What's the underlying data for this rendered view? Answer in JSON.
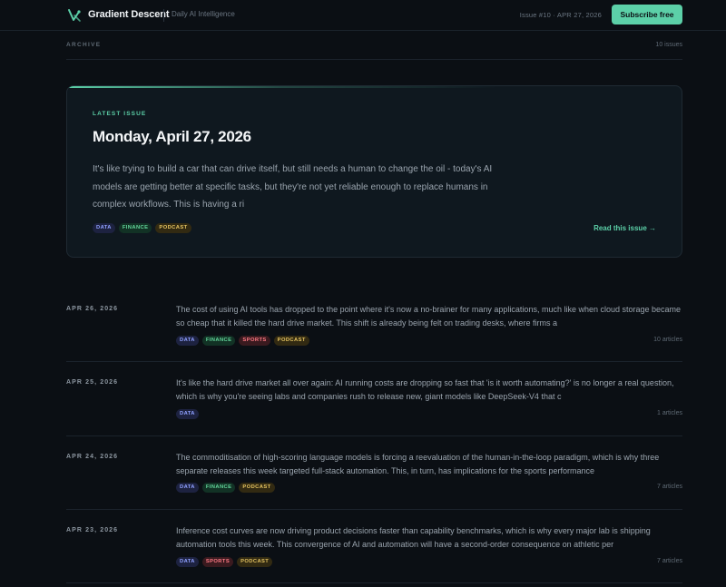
{
  "header": {
    "brand": "Gradient Descent",
    "tagline": "Daily AI Intelligence",
    "issue_meta": "Issue #10 · APR 27, 2026",
    "subscribe_label": "Subscribe free",
    "logo_icon": "gradient-descent-logo-icon",
    "accent_color": "#5cd0a8"
  },
  "archive": {
    "label": "ARCHIVE",
    "count": "10 issues"
  },
  "featured": {
    "label": "LATEST ISSUE",
    "title": "Monday, April 27, 2026",
    "excerpt": "It's like trying to build a car that can drive itself, but still needs a human to change the oil - today's AI models are getting better at specific tasks, but they're not yet reliable enough to replace humans in complex workflows. This is having a ri",
    "tags": [
      "DATA",
      "FINANCE",
      "PODCAST"
    ],
    "read_label": "Read this issue →"
  },
  "issues": [
    {
      "date": "APR 26, 2026",
      "summary": "The cost of using AI tools has dropped to the point where it's now a no-brainer for many applications, much like when cloud storage became so cheap that it killed the hard drive market. This shift is already being felt on trading desks, where firms a",
      "tags": [
        "DATA",
        "FINANCE",
        "SPORTS",
        "PODCAST"
      ],
      "count": "10 articles"
    },
    {
      "date": "APR 25, 2026",
      "summary": "It's like the hard drive market all over again: AI running costs are dropping so fast that 'is it worth automating?' is no longer a real question, which is why you're seeing labs and companies rush to release new, giant models like DeepSeek-V4 that c",
      "tags": [
        "DATA"
      ],
      "count": "1 articles"
    },
    {
      "date": "APR 24, 2026",
      "summary": "The commoditisation of high-scoring language models is forcing a reevaluation of the human-in-the-loop paradigm, which is why three separate releases this week targeted full-stack automation. This, in turn, has implications for the sports performance",
      "tags": [
        "DATA",
        "FINANCE",
        "PODCAST"
      ],
      "count": "7 articles"
    },
    {
      "date": "APR 23, 2026",
      "summary": "Inference cost curves are now driving product decisions faster than capability benchmarks, which is why every major lab is shipping automation tools this week. This convergence of AI and automation will have a second-order consequence on athletic per",
      "tags": [
        "DATA",
        "SPORTS",
        "PODCAST"
      ],
      "count": "7 articles"
    }
  ]
}
